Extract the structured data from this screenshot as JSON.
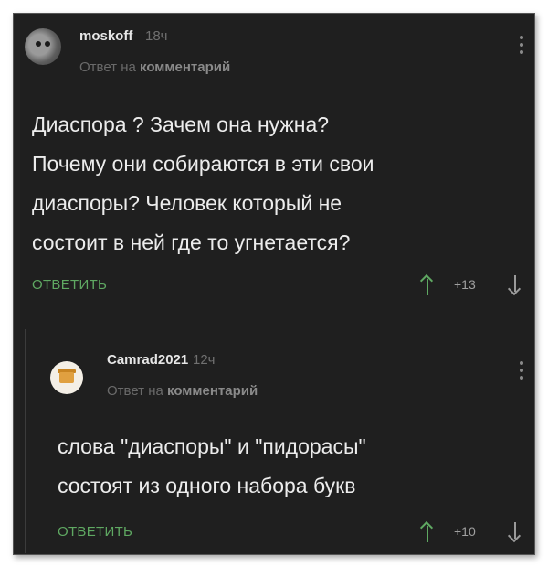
{
  "comments": [
    {
      "username": "moskoff",
      "time": "18ч",
      "reply_prefix": "Ответ на",
      "reply_target": "комментарий",
      "text": "Диаспора ? Зачем она нужна?\nПочему они собираются в эти свои\nдиаспоры? Человек который не\nсостоит в ней где то угнетается?",
      "reply_label": "ОТВЕТИТЬ",
      "score": "+13"
    },
    {
      "username": "Camrad2021",
      "time": "12ч",
      "reply_prefix": "Ответ на",
      "reply_target": "комментарий",
      "text": "слова \"диаспоры\" и \"пидорасы\"\nсостоят из одного набора букв",
      "reply_label": "ОТВЕТИТЬ",
      "score": "+10"
    }
  ],
  "colors": {
    "background": "#1f1f1f",
    "accent_green": "#5fa862",
    "text": "#ececec",
    "muted": "#6a6a6a"
  },
  "icons": [
    "avatar-owl",
    "avatar-box",
    "menu-dots-icon",
    "upvote-arrow-icon",
    "downvote-arrow-icon"
  ]
}
